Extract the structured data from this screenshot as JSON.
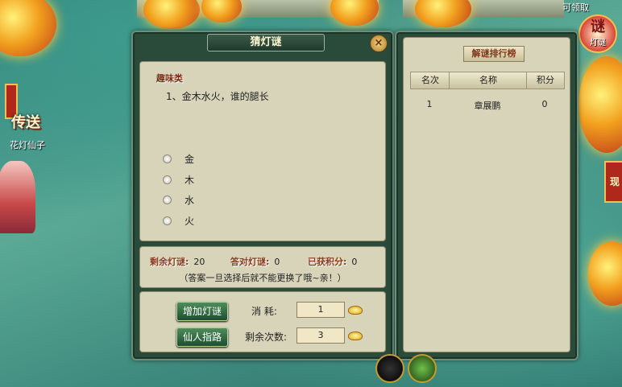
{
  "hud": {
    "claim_text": "可领取",
    "riddle_badge": "谜",
    "riddle_badge_sub": "灯谜",
    "teleport_label": "传送",
    "npc_name": "花灯仙子",
    "side_tab": "现"
  },
  "dialog": {
    "title": "猜灯谜",
    "close_icon": "×",
    "category": "趣味类",
    "question": "1、金木水火，谁的腿长",
    "options": [
      "金",
      "木",
      "水",
      "火"
    ],
    "stats": {
      "remaining_label": "剩余灯谜:",
      "remaining_value": "20",
      "correct_label": "答对灯谜:",
      "correct_value": "0",
      "score_label": "已获积分:",
      "score_value": "0"
    },
    "notice": "（答案一旦选择后就不能更换了哦~亲！）",
    "add_button": "增加灯谜",
    "hint_button": "仙人指路",
    "cost_label": "消  耗:",
    "cost_value": "1",
    "times_label": "剩余次数:",
    "times_value": "3"
  },
  "ranking": {
    "title": "解谜排行榜",
    "columns": [
      "名次",
      "名称",
      "积分"
    ],
    "rows": [
      {
        "rank": "1",
        "name": "章展鹏",
        "score": "0"
      }
    ]
  },
  "colors": {
    "panel_bg": "#2a4a3a",
    "inner_bg": "#d8d4ba",
    "label_red": "#8a3a1a",
    "button_green": "#2f6b3e"
  }
}
